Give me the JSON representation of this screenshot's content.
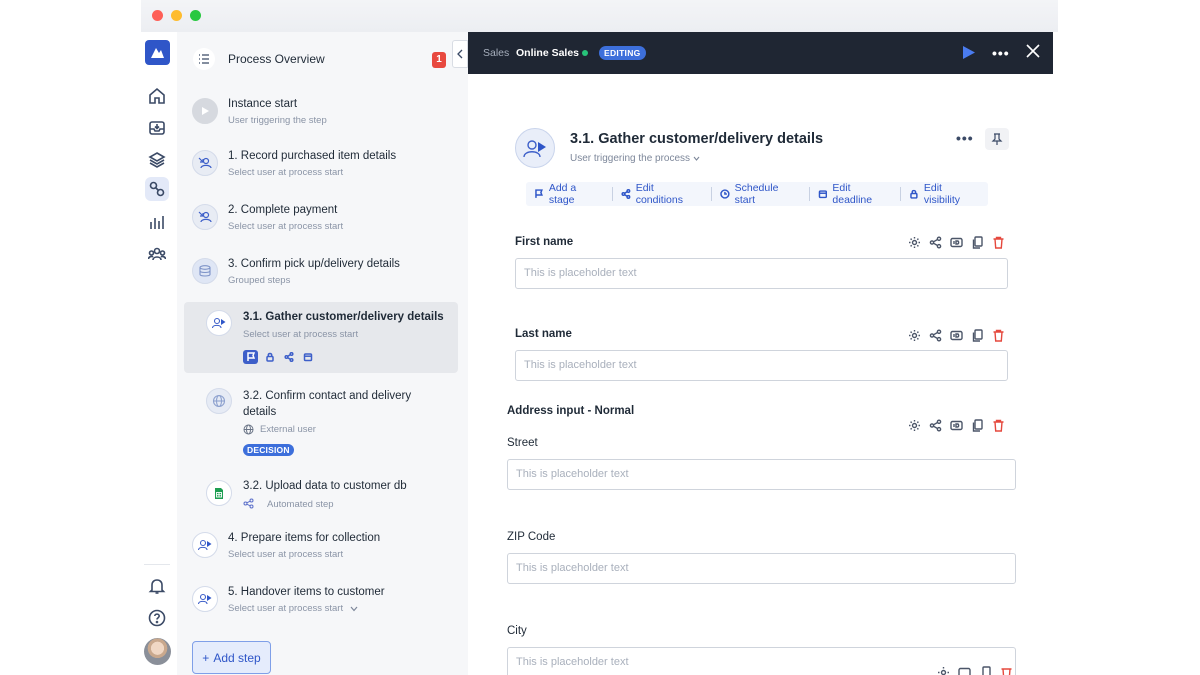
{
  "sidebar": {
    "title": "Process Overview",
    "badge": "1",
    "steps": [
      {
        "title": "Instance start",
        "subtitle": "User triggering the step"
      },
      {
        "title": "1. Record purchased item details",
        "subtitle": "Select user at process start"
      },
      {
        "title": "2. Complete payment",
        "subtitle": "Select user at process start"
      },
      {
        "title": "3. Confirm pick up/delivery details",
        "subtitle": "Grouped steps"
      },
      {
        "title": "3.1. Gather customer/delivery details",
        "subtitle": "Select user at process start"
      },
      {
        "title": "3.2. Confirm contact and delivery details",
        "subtitle": "External user",
        "tag": "DECISION"
      },
      {
        "title": "3.2. Upload data to customer db",
        "subtitle": "Automated step"
      },
      {
        "title": "4. Prepare items for collection",
        "subtitle": "Select user at process start"
      },
      {
        "title": "5. Handover items to customer",
        "subtitle": "Select user at process start"
      }
    ],
    "add_step": "Add step"
  },
  "topbar": {
    "crumb1": "Sales",
    "crumb2": "Online Sales",
    "status": "EDITING"
  },
  "step": {
    "title": "3.1. Gather customer/delivery details",
    "subtitle": "User triggering the process"
  },
  "actions": [
    "Add a stage",
    "Edit conditions",
    "Schedule start",
    "Edit deadline",
    "Edit visibility"
  ],
  "form": {
    "first_name": {
      "label": "First name",
      "placeholder": "This is placeholder text"
    },
    "last_name": {
      "label": "Last name",
      "placeholder": "This is placeholder text"
    },
    "address_group": "Address input - Normal",
    "street": {
      "label": "Street",
      "placeholder": "This is placeholder text"
    },
    "zip": {
      "label": "ZIP Code",
      "placeholder": "This is placeholder text"
    },
    "city": {
      "label": "City",
      "placeholder": "This is placeholder text"
    }
  },
  "colors": {
    "brand": "#2f56c8",
    "topbar": "#1f2633",
    "accent": "#3d6fdb",
    "danger": "#e5483d",
    "live": "#27c37a"
  }
}
